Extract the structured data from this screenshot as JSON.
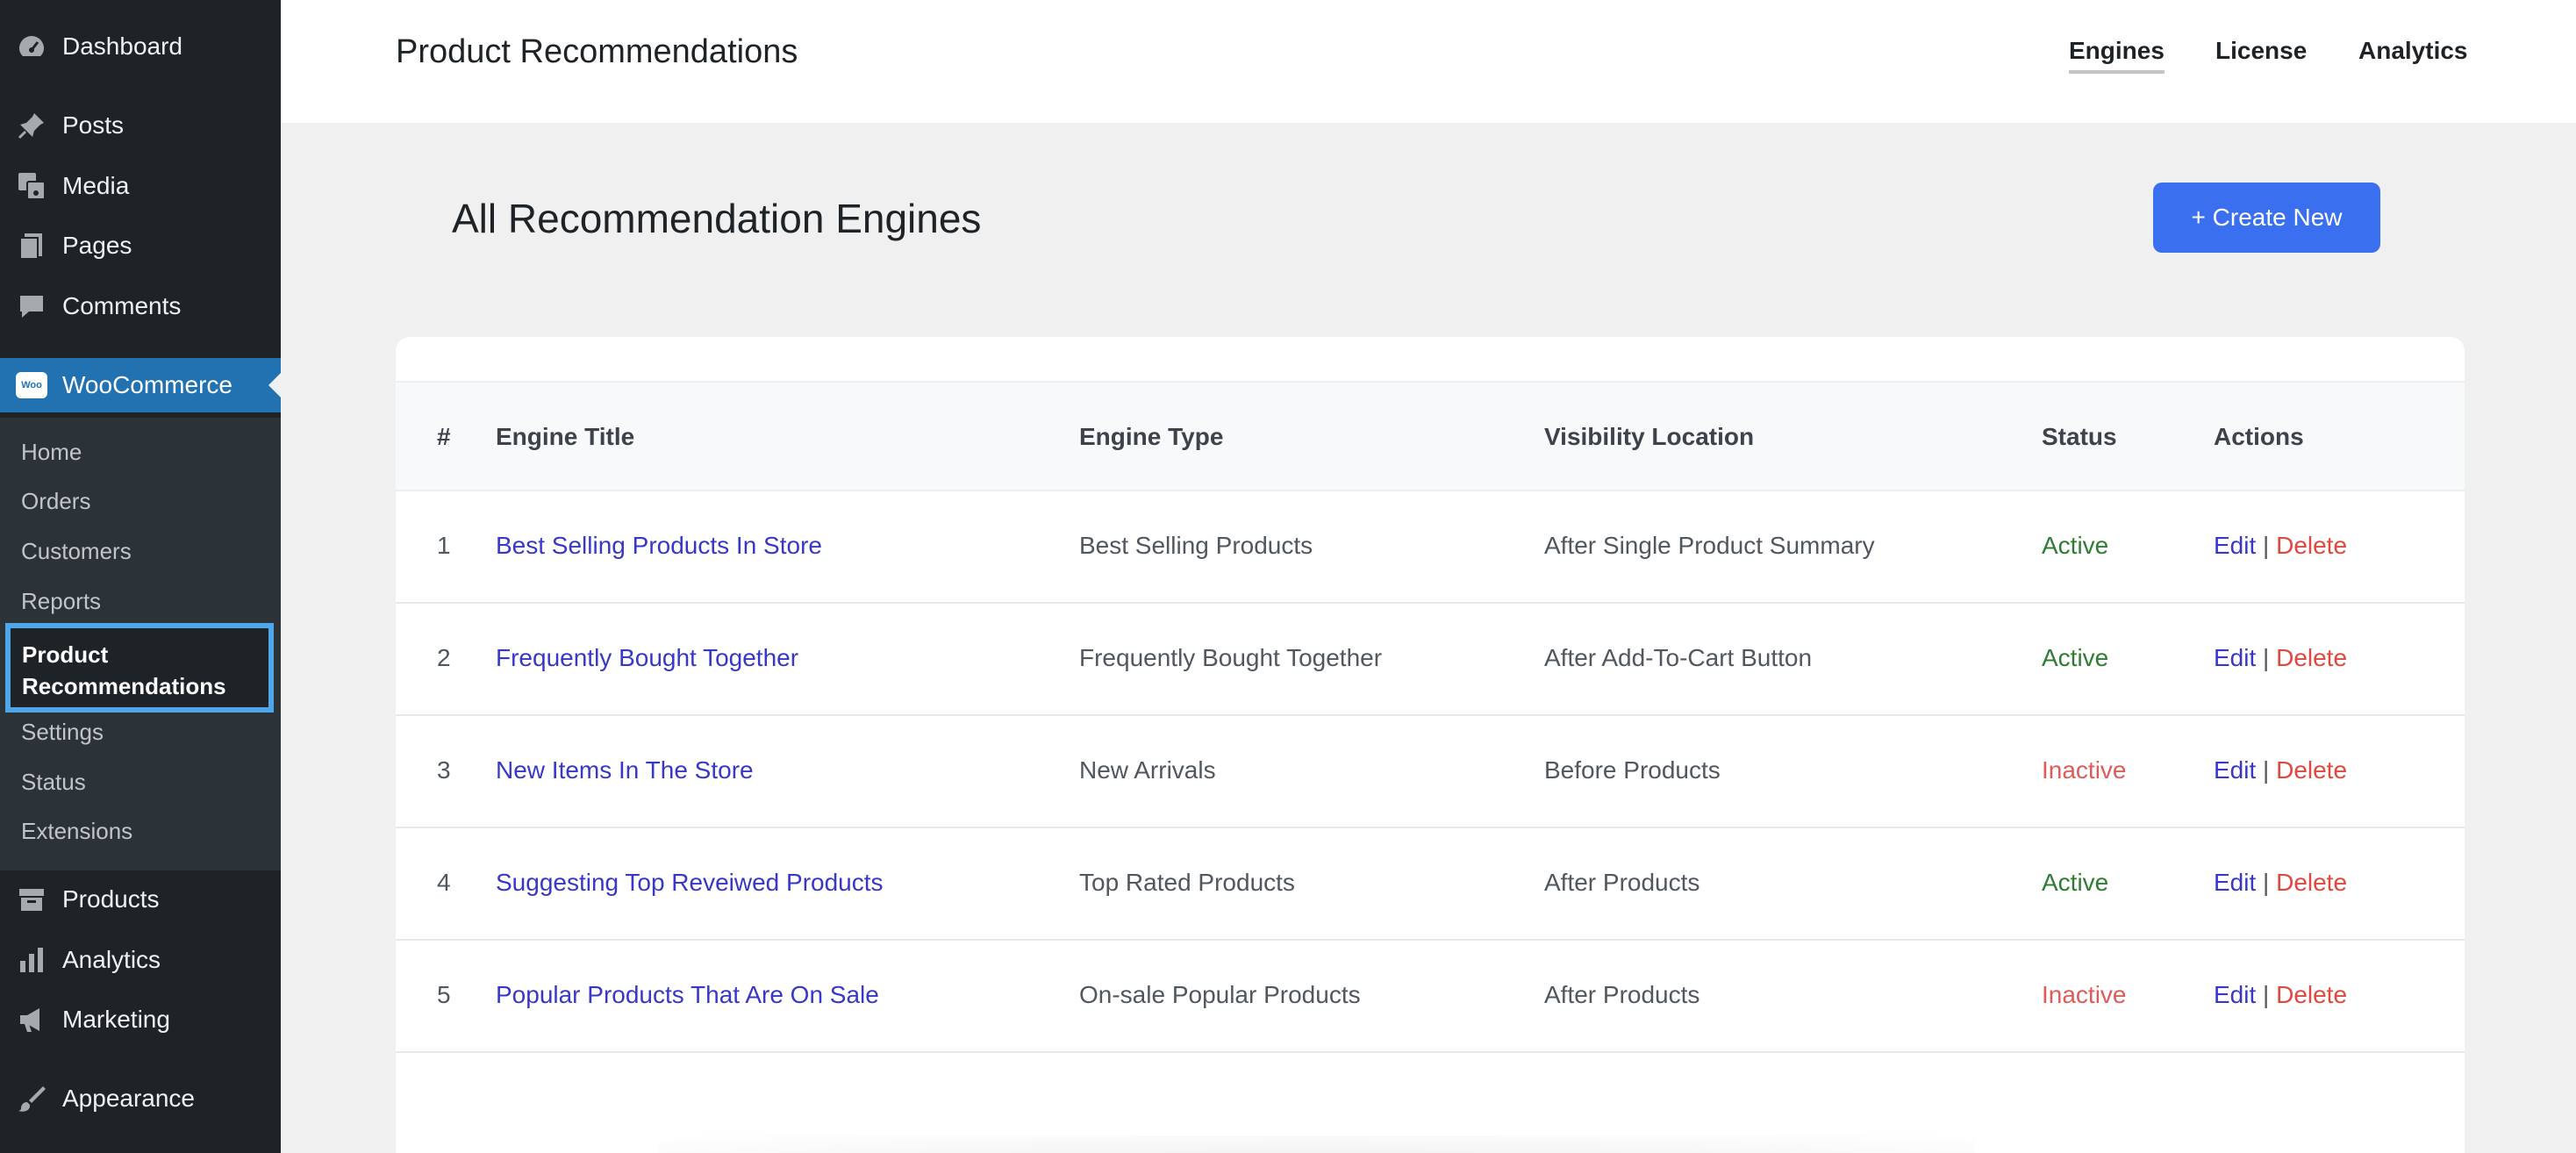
{
  "sidebar": {
    "items": [
      {
        "label": "Dashboard",
        "icon": "dashboard-icon"
      },
      {
        "label": "Posts",
        "icon": "pin-icon"
      },
      {
        "label": "Media",
        "icon": "media-icon"
      },
      {
        "label": "Pages",
        "icon": "pages-icon"
      },
      {
        "label": "Comments",
        "icon": "comment-icon"
      },
      {
        "label": "WooCommerce",
        "icon": "woo-logo-icon"
      },
      {
        "label": "Products",
        "icon": "archive-icon"
      },
      {
        "label": "Analytics",
        "icon": "bar-chart-icon"
      },
      {
        "label": "Marketing",
        "icon": "megaphone-icon"
      },
      {
        "label": "Appearance",
        "icon": "brush-icon"
      }
    ],
    "woo_logo_text": "Woo",
    "submenu": [
      {
        "label": "Home"
      },
      {
        "label": "Orders"
      },
      {
        "label": "Customers"
      },
      {
        "label": "Reports"
      },
      {
        "label": "Product Recommendations"
      },
      {
        "label": "Settings"
      },
      {
        "label": "Status"
      },
      {
        "label": "Extensions"
      }
    ],
    "active_submenu": [
      "Product",
      "Recommendations"
    ]
  },
  "header": {
    "title": "Product Recommendations",
    "tabs": [
      {
        "label": "Engines",
        "active": true
      },
      {
        "label": "License",
        "active": false
      },
      {
        "label": "Analytics",
        "active": false
      }
    ]
  },
  "main": {
    "heading": "All Recommendation Engines",
    "create_button": "+ Create New",
    "table": {
      "columns": [
        "#",
        "Engine Title",
        "Engine Type",
        "Visibility Location",
        "Status",
        "Actions"
      ],
      "rows": [
        {
          "num": "1",
          "title": "Best Selling Products In Store",
          "type": "Best Selling Products",
          "location": "After Single Product Summary",
          "status": "Active"
        },
        {
          "num": "2",
          "title": "Frequently Bought Together",
          "type": "Frequently Bought Together",
          "location": "After Add-To-Cart Button",
          "status": "Active"
        },
        {
          "num": "3",
          "title": "New Items In The Store",
          "type": "New Arrivals",
          "location": "Before Products",
          "status": "Inactive"
        },
        {
          "num": "4",
          "title": "Suggesting Top Reveiwed Products",
          "type": "Top Rated Products",
          "location": "After Products",
          "status": "Active"
        },
        {
          "num": "5",
          "title": "Popular Products That Are On Sale",
          "type": "On-sale Popular Products",
          "location": "After Products",
          "status": "Inactive"
        }
      ],
      "edit_label": "Edit",
      "separator": "|",
      "delete_label": "Delete"
    }
  },
  "colors": {
    "sidebar_bg": "#1d2327",
    "woo_active": "#2271b1",
    "primary_button": "#3a6ff0",
    "link": "#3838c8",
    "active_status": "#2e7d32",
    "inactive_status": "#e05a5a",
    "delete": "#e0483e"
  }
}
